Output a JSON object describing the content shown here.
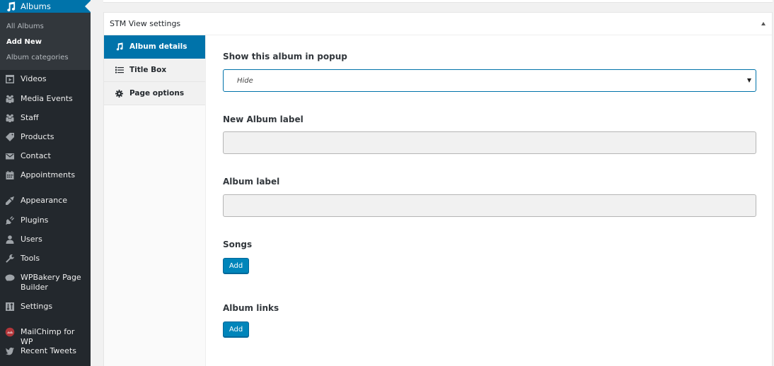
{
  "sidebar": {
    "current": {
      "label": "Albums",
      "icon": "music-note-icon"
    },
    "submenu": [
      {
        "label": "All Albums",
        "current": false
      },
      {
        "label": "Add New",
        "current": true
      },
      {
        "label": "Album categories",
        "current": false
      }
    ],
    "items": [
      {
        "label": "Videos",
        "icon": "video-icon"
      },
      {
        "label": "Media Events",
        "icon": "groups-icon"
      },
      {
        "label": "Staff",
        "icon": "groups-icon"
      },
      {
        "label": "Products",
        "icon": "tag-icon"
      },
      {
        "label": "Contact",
        "icon": "envelope-icon"
      },
      {
        "label": "Appointments",
        "icon": "calendar-icon"
      },
      {
        "label": "Appearance",
        "icon": "paintbrush-icon"
      },
      {
        "label": "Plugins",
        "icon": "plugin-icon"
      },
      {
        "label": "Users",
        "icon": "user-icon"
      },
      {
        "label": "Tools",
        "icon": "wrench-icon"
      },
      {
        "label": "WPBakery Page Builder",
        "line1": "WPBakery Page",
        "line2": "Builder",
        "icon": "cloud-icon"
      },
      {
        "label": "Settings",
        "icon": "settings-icon"
      },
      {
        "label": "MailChimp for WP",
        "icon": "mailchimp-icon"
      },
      {
        "label": "Recent Tweets",
        "icon": "twitter-icon"
      }
    ]
  },
  "metabox": {
    "title": "STM View settings",
    "tabs": [
      {
        "label": "Album details",
        "icon": "music-note-icon",
        "active": true
      },
      {
        "label": "Title Box",
        "icon": "list-icon",
        "active": false
      },
      {
        "label": "Page options",
        "icon": "gear-icon",
        "active": false
      }
    ],
    "fields": {
      "popup": {
        "label": "Show this album in popup",
        "value": "Hide"
      },
      "new_album_label": {
        "label": "New Album label",
        "value": ""
      },
      "album_label": {
        "label": "Album label",
        "value": ""
      },
      "songs": {
        "label": "Songs",
        "button": "Add"
      },
      "album_links": {
        "label": "Album links",
        "button": "Add"
      }
    }
  },
  "colors": {
    "accent": "#0073aa",
    "sidebar_bg": "#23282d",
    "submenu_bg": "#32373c",
    "button_bg": "#0085ba"
  }
}
